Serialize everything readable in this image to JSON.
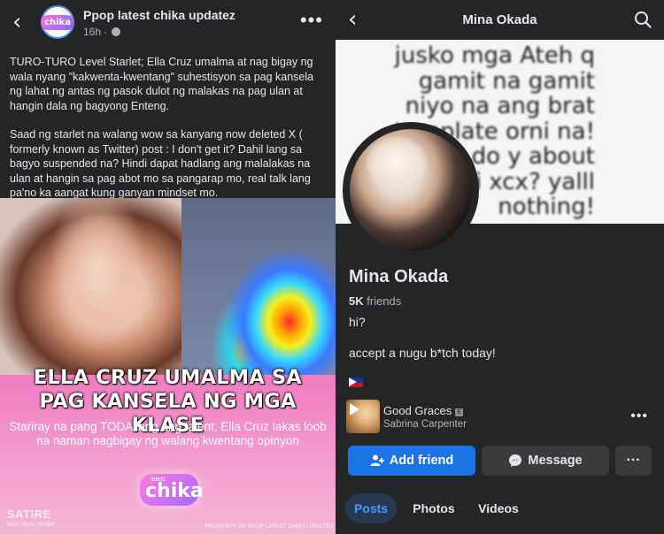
{
  "left_post": {
    "page_name": "Ppop latest chika updatez",
    "timestamp": "16h",
    "separator": "·",
    "avatar_label": "chika",
    "paragraph1": "TURO-TURO Level Starlet; Ella Cruz umalma at nag bigay ng wala nyang \"kakwenta-kwentang\" suhestisyon sa pag kansela ng lahat ng antas ng pasok dulot ng malakas na pag ulan at hangin dala ng bagyong Enteng.",
    "paragraph2": "Saad ng starlet na walang wow sa kanyang now deleted X ( formerly known as Twitter) post : I don't get it? Dahil lang sa bagyo suspended na? Hindi dapat hadlang ang malalakas na ulan at hangin sa pag abot mo sa pangarap mo, real talk lang pa'no ka aangat kung ganyan mindset mo.",
    "image": {
      "headline_line1": "ELLA CRUZ UMALMA SA",
      "headline_line2": "PAG KANSELA NG MGA KLASE",
      "subhead": "Stariray na pang TODA lang ang talent; Ella Cruz lakas loob na naman nagbigay ng walang kwentang opinyon",
      "logo_small": "latest",
      "logo_word": "chika",
      "satire": "SATIRE",
      "satire_sub": "NOT REAL NEWS",
      "property": "PROPERTY OF PPOP LATEST CHIKA UPDATES"
    }
  },
  "right_profile": {
    "header_title": "Mina Okada",
    "cover_text": "jusko mga Ateh q gamit na gamit niyo na ang brat template orni na! what do y about brat rli xcx? yalll nothing!",
    "name": "Mina Okada",
    "friends_count": "5K",
    "friends_label": "friends",
    "bio_line1": "hi?",
    "bio_line2": "accept a nugu b*tch today!",
    "song": {
      "title": "Good Graces",
      "explicit_badge": "E",
      "artist": "Sabrina Carpenter"
    },
    "buttons": {
      "add_friend": "Add friend",
      "message": "Message",
      "more": "···"
    },
    "tabs": [
      "Posts",
      "Photos",
      "Videos"
    ]
  },
  "colors": {
    "background": "#242526",
    "primary_blue": "#1b74e4",
    "secondary_button": "#3a3b3c",
    "active_tab_text": "#4599ff"
  }
}
